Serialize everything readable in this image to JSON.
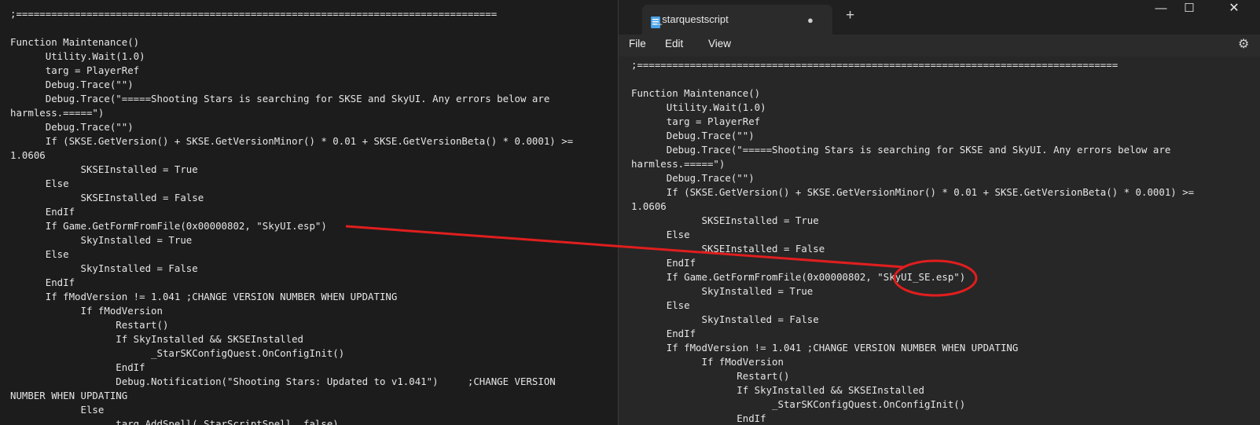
{
  "left": {
    "lines": [
      ";==================================================================================",
      "",
      "Function Maintenance()",
      "      Utility.Wait(1.0)",
      "      targ = PlayerRef",
      "      Debug.Trace(\"\")",
      "      Debug.Trace(\"=====Shooting Stars is searching for SKSE and SkyUI. Any errors below are",
      "harmless.=====\")",
      "      Debug.Trace(\"\")",
      "      If (SKSE.GetVersion() + SKSE.GetVersionMinor() * 0.01 + SKSE.GetVersionBeta() * 0.0001) >=",
      "1.0606",
      "            SKSEInstalled = True",
      "      Else",
      "            SKSEInstalled = False",
      "      EndIf",
      "      If Game.GetFormFromFile(0x00000802, \"SkyUI.esp\")",
      "            SkyInstalled = True",
      "      Else",
      "            SkyInstalled = False",
      "      EndIf",
      "      If fModVersion != 1.041 ;CHANGE VERSION NUMBER WHEN UPDATING",
      "            If fModVersion",
      "                  Restart()",
      "                  If SkyInstalled && SKSEInstalled",
      "                        _StarSKConfigQuest.OnConfigInit()",
      "                  EndIf",
      "                  Debug.Notification(\"Shooting Stars: Updated to v1.041\")     ;CHANGE VERSION",
      "NUMBER WHEN UPDATING",
      "            Else",
      "                  targ.AddSpell(_StarScriptSpell, false)"
    ]
  },
  "window": {
    "tab_title": "_starquestscript",
    "tab_modified_dot": "●",
    "new_tab": "+",
    "minimize": "—",
    "maximize": "☐",
    "close": "✕",
    "settings_icon": "⚙",
    "menu": {
      "file": "File",
      "edit": "Edit",
      "view": "View"
    }
  },
  "right": {
    "lines": [
      ";==================================================================================",
      "",
      "Function Maintenance()",
      "      Utility.Wait(1.0)",
      "      targ = PlayerRef",
      "      Debug.Trace(\"\")",
      "      Debug.Trace(\"=====Shooting Stars is searching for SKSE and SkyUI. Any errors below are",
      "harmless.=====\")",
      "      Debug.Trace(\"\")",
      "      If (SKSE.GetVersion() + SKSE.GetVersionMinor() * 0.01 + SKSE.GetVersionBeta() * 0.0001) >=",
      "1.0606",
      "            SKSEInstalled = True",
      "      Else",
      "            SKSEInstalled = False",
      "      EndIf",
      "      If Game.GetFormFromFile(0x00000802, \"SkyUI_SE.esp\")",
      "            SkyInstalled = True",
      "      Else",
      "            SkyInstalled = False",
      "      EndIf",
      "      If fModVersion != 1.041 ;CHANGE VERSION NUMBER WHEN UPDATING",
      "            If fModVersion",
      "                  Restart()",
      "                  If SkyInstalled && SKSEInstalled",
      "                        _StarSKConfigQuest.OnConfigInit()",
      "                  EndIf"
    ]
  },
  "colors": {
    "annotation": "#e01e1e",
    "text": "#e6e6e6",
    "background_left": "#1c1c1c",
    "background_right": "#272727"
  }
}
